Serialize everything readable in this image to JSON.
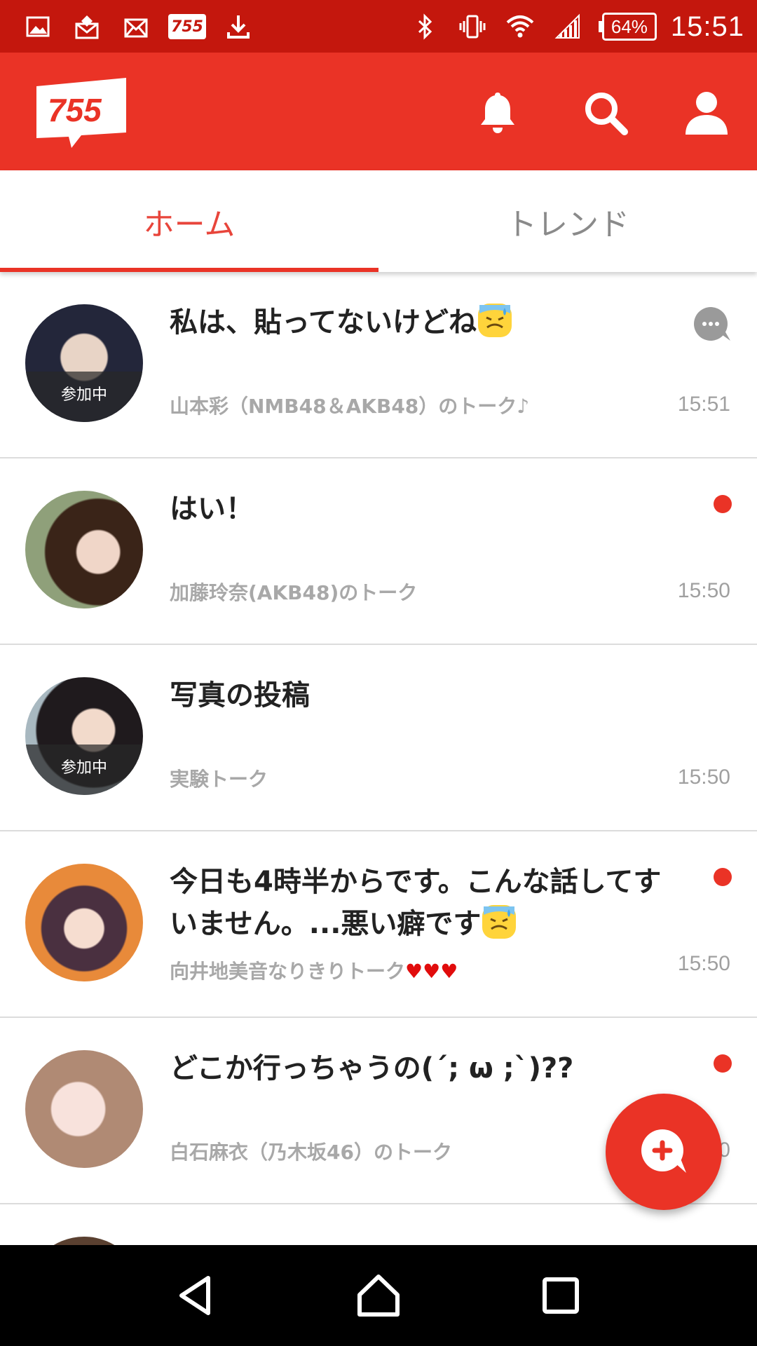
{
  "status_bar": {
    "left_icons": [
      "image-icon",
      "mail-notice-icon",
      "mail-icon",
      "app-755-icon",
      "download-icon"
    ],
    "app_icon_text": "755",
    "right_icons": [
      "bluetooth-icon",
      "vibrate-icon",
      "wifi-icon",
      "signal-icon",
      "battery-icon"
    ],
    "battery": "64%",
    "time": "15:51"
  },
  "app_bar": {
    "logo_text": "755",
    "actions": [
      "bell-icon",
      "search-icon",
      "profile-icon"
    ]
  },
  "tabs": [
    {
      "label": "ホーム",
      "active": true
    },
    {
      "label": "トレンド",
      "active": false
    }
  ],
  "talks": [
    {
      "title": "私は、貼ってないけどね",
      "title_emoji": "sweat-emoji",
      "subtitle": "山本彩（NMB48＆AKB48）のトーク♪",
      "time": "15:51",
      "badge": "参加中",
      "indicator": "chat-bubble"
    },
    {
      "title": "はい！",
      "subtitle": "加藤玲奈(AKB48)のトーク",
      "time": "15:50",
      "badge": "",
      "indicator": "unread-dot"
    },
    {
      "title": "写真の投稿",
      "subtitle": "実験トーク",
      "time": "15:50",
      "badge": "参加中",
      "indicator": "none"
    },
    {
      "title": "今日も4時半からです。こんな話してすいません。...悪い癖です",
      "title_emoji": "sweat-emoji",
      "subtitle": "向井地美音なりきりトーク",
      "subtitle_hearts": "♥♥♥",
      "time": "15:50",
      "badge": "",
      "indicator": "unread-dot"
    },
    {
      "title": "どこか行っちゃうの(´; ω ;`)??",
      "subtitle": "白石麻衣（乃木坂46）のトーク",
      "time": "15:50",
      "badge": "",
      "indicator": "unread-dot"
    }
  ],
  "colors": {
    "status_bar": "#c4170d",
    "app_bar": "#ea3326",
    "accent": "#e8453b",
    "unread": "#ea3326"
  },
  "fab": {
    "icon": "new-talk-plus-icon"
  },
  "nav_bar": {
    "buttons": [
      "back-icon",
      "home-icon",
      "recents-icon"
    ]
  }
}
